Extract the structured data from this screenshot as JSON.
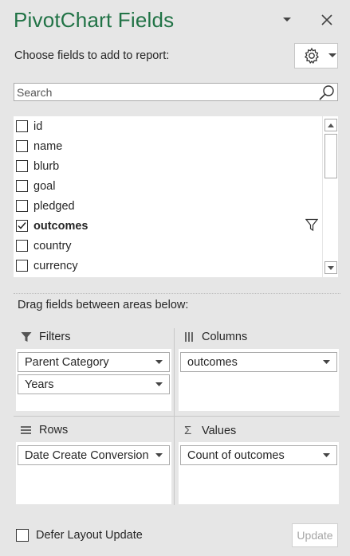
{
  "pane": {
    "title": "PivotChart Fields",
    "subtitle": "Choose fields to add to report:",
    "accent_color": "#217346"
  },
  "search": {
    "placeholder": "Search",
    "value": ""
  },
  "fields": [
    {
      "label": "id",
      "checked": false,
      "bold": false
    },
    {
      "label": "name",
      "checked": false,
      "bold": false
    },
    {
      "label": "blurb",
      "checked": false,
      "bold": false
    },
    {
      "label": "goal",
      "checked": false,
      "bold": false
    },
    {
      "label": "pledged",
      "checked": false,
      "bold": false
    },
    {
      "label": "outcomes",
      "checked": true,
      "bold": true,
      "filtered": true
    },
    {
      "label": "country",
      "checked": false,
      "bold": false
    },
    {
      "label": "currency",
      "checked": false,
      "bold": false
    }
  ],
  "areas": {
    "drag_label": "Drag fields between areas below:",
    "filters": {
      "label": "Filters",
      "items": [
        "Parent Category",
        "Years"
      ]
    },
    "columns": {
      "label": "Columns",
      "items": [
        "outcomes"
      ]
    },
    "rows": {
      "label": "Rows",
      "items": [
        "Date Create Conversion"
      ]
    },
    "values": {
      "label": "Values",
      "items": [
        "Count of outcomes"
      ]
    }
  },
  "footer": {
    "defer_label": "Defer Layout Update",
    "defer_checked": false,
    "update_label": "Update"
  }
}
